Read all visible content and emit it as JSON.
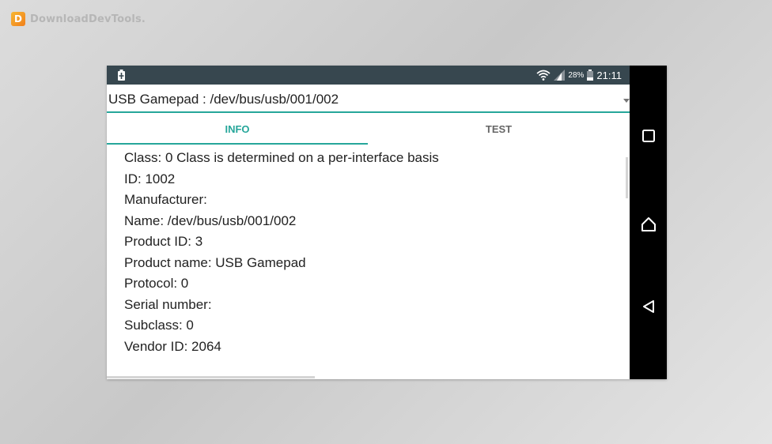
{
  "watermark": {
    "logo_letter": "D",
    "text": "DownloadDevTools."
  },
  "status_bar": {
    "battery_level": "28%",
    "time": "21:11",
    "icons": [
      "battery-charging-icon",
      "wifi-icon",
      "signal-icon",
      "battery-icon"
    ]
  },
  "device_spinner": {
    "selected": "USB Gamepad : /dev/bus/usb/001/002"
  },
  "tabs": [
    {
      "label": "INFO",
      "active": true
    },
    {
      "label": "TEST",
      "active": false
    }
  ],
  "info": {
    "lines": [
      "Class: 0 Class is determined on a per-interface basis",
      "ID: 1002",
      "Manufacturer:",
      "Name: /dev/bus/usb/001/002",
      "Product ID: 3",
      "Product name: USB Gamepad",
      "Protocol: 0",
      "Serial number:",
      "Subclass: 0",
      "Vendor ID: 2064"
    ]
  },
  "nav_bar": {
    "buttons": [
      "recents-icon",
      "home-icon",
      "back-icon"
    ]
  },
  "colors": {
    "accent": "#26a69a",
    "status_bar": "#37474f",
    "nav_bar": "#000000"
  }
}
